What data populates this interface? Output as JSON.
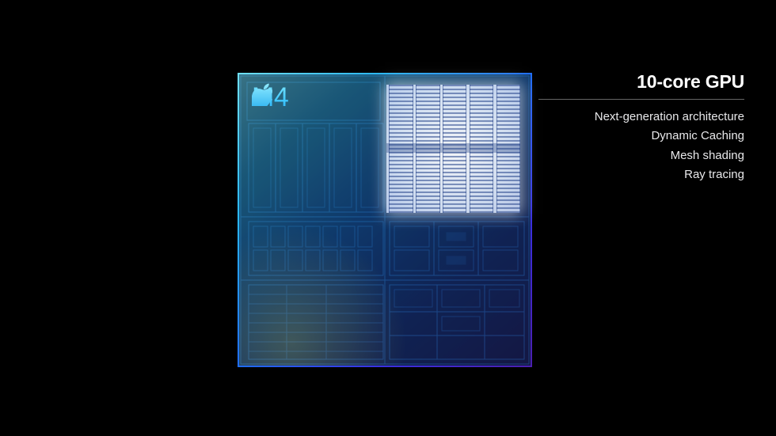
{
  "chip": {
    "name": "M4"
  },
  "features": {
    "title": "10-core GPU",
    "items": [
      "Next-generation architecture",
      "Dynamic Caching",
      "Mesh shading",
      "Ray tracing"
    ]
  }
}
